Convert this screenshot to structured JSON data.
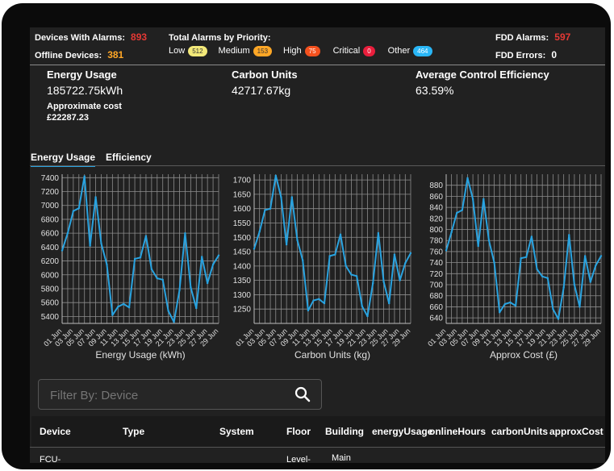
{
  "header": {
    "devices_with_alarms_label": "Devices With Alarms:",
    "devices_with_alarms_value": "893",
    "offline_devices_label": "Offline Devices:",
    "offline_devices_value": "381",
    "total_alarms_label": "Total Alarms by Priority:",
    "priorities": [
      {
        "label": "Low",
        "count": "512",
        "color": "#f3e979",
        "text_color": "#333333"
      },
      {
        "label": "Medium",
        "count": "153",
        "color": "#ffa726",
        "text_color": "#333333"
      },
      {
        "label": "High",
        "count": "75",
        "color": "#f4511e",
        "text_color": "#ffffff"
      },
      {
        "label": "Critical",
        "count": "0",
        "color": "#e91e3c",
        "text_color": "#ffffff"
      },
      {
        "label": "Other",
        "count": "464",
        "color": "#29b6f6",
        "text_color": "#ffffff"
      }
    ],
    "fdd_alarms_label": "FDD Alarms:",
    "fdd_alarms_value": "597",
    "fdd_errors_label": "FDD Errors:",
    "fdd_errors_value": "0"
  },
  "colors": {
    "alarm_red": "#e53935",
    "offline_orange": "#ffa726",
    "line_blue": "#29a3e0",
    "background": "#212121"
  },
  "summary": {
    "energy_title": "Energy Usage",
    "energy_value": "185722.75kWh",
    "approx_cost_label": "Approximate cost",
    "approx_cost_value": "£22287.23",
    "carbon_title": "Carbon Units",
    "carbon_value": "42717.67kg",
    "efficiency_title": "Average Control Efficiency",
    "efficiency_value": "63.59%"
  },
  "tabs": [
    {
      "label": "Energy Usage"
    },
    {
      "label": "Efficiency"
    }
  ],
  "chart_data": [
    {
      "type": "line",
      "title": "",
      "xlabel": "Energy Usage (kWh)",
      "ylabel": "",
      "ylim": [
        5300,
        7450
      ],
      "yticks": [
        5400,
        5600,
        5800,
        6000,
        6200,
        6400,
        6600,
        6800,
        7000,
        7200,
        7400
      ],
      "ytick_labels": [
        "5400",
        "5600",
        "5800",
        "6000",
        "6200",
        "6400",
        "6600",
        "6800",
        "7000",
        "7200",
        "7400"
      ],
      "xtick_labels": [
        "01 Jun",
        "03 Jun",
        "05 Jun",
        "07 Jun",
        "09 Jun",
        "11 Jun",
        "13 Jun",
        "15 Jun",
        "17 Jun",
        "19 Jun",
        "21 Jun",
        "23 Jun",
        "25 Jun",
        "27 Jun",
        "29 Jun"
      ],
      "grid": true,
      "values": [
        6350,
        6600,
        6920,
        6960,
        7420,
        6420,
        7120,
        6450,
        6150,
        5420,
        5540,
        5580,
        5530,
        6230,
        6250,
        6560,
        6080,
        5950,
        5930,
        5480,
        5320,
        5780,
        6600,
        5820,
        5520,
        6260,
        5880,
        6150,
        6280
      ]
    },
    {
      "type": "line",
      "title": "",
      "xlabel": "Carbon Units (kg)",
      "ylabel": "",
      "ylim": [
        1200,
        1720
      ],
      "yticks": [
        1250,
        1300,
        1350,
        1400,
        1450,
        1500,
        1550,
        1600,
        1650,
        1700
      ],
      "ytick_labels": [
        "1250",
        "1300",
        "1350",
        "1400",
        "1450",
        "1500",
        "1550",
        "1600",
        "1650",
        "1700"
      ],
      "xtick_labels": [
        "01 Jun",
        "03 Jun",
        "05 Jun",
        "07 Jun",
        "09 Jun",
        "11 Jun",
        "13 Jun",
        "15 Jun",
        "17 Jun",
        "19 Jun",
        "21 Jun",
        "23 Jun",
        "25 Jun",
        "27 Jun",
        "29 Jun"
      ],
      "grid": true,
      "values": [
        1460,
        1520,
        1595,
        1600,
        1715,
        1640,
        1475,
        1640,
        1490,
        1420,
        1245,
        1280,
        1285,
        1270,
        1435,
        1440,
        1510,
        1400,
        1370,
        1365,
        1260,
        1225,
        1340,
        1515,
        1345,
        1270,
        1440,
        1350,
        1410,
        1445
      ]
    },
    {
      "type": "line",
      "title": "",
      "xlabel": "Approx Cost (£)",
      "ylabel": "",
      "ylim": [
        630,
        900
      ],
      "yticks": [
        640,
        660,
        680,
        700,
        720,
        740,
        760,
        780,
        800,
        820,
        840,
        860,
        880
      ],
      "ytick_labels": [
        "640",
        "660",
        "680",
        "700",
        "720",
        "740",
        "760",
        "780",
        "800",
        "820",
        "840",
        "860",
        "880"
      ],
      "xtick_labels": [
        "01 Jun",
        "03 Jun",
        "05 Jun",
        "07 Jun",
        "09 Jun",
        "11 Jun",
        "13 Jun",
        "15 Jun",
        "17 Jun",
        "19 Jun",
        "21 Jun",
        "23 Jun",
        "25 Jun",
        "27 Jun",
        "29 Jun"
      ],
      "grid": true,
      "values": [
        762,
        795,
        830,
        835,
        893,
        855,
        770,
        855,
        780,
        740,
        650,
        665,
        668,
        662,
        748,
        750,
        787,
        728,
        715,
        712,
        656,
        638,
        695,
        790,
        700,
        660,
        752,
        705,
        735,
        752
      ]
    }
  ],
  "filter": {
    "placeholder": "Filter By: Device",
    "icon": "search-icon"
  },
  "table": {
    "headers": [
      "Device",
      "Type",
      "System",
      "Floor",
      "Building",
      "energyUsage",
      "onlineHours",
      "carbonUnits",
      "approxCost"
    ],
    "partial_row": [
      "FCU-",
      "Level-",
      "Main"
    ]
  }
}
